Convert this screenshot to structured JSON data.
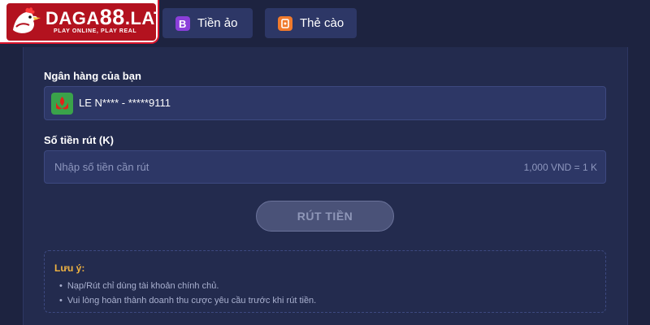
{
  "brand": {
    "name_prefix": "DAGA",
    "name_number": "88",
    "name_suffix": ".LAT",
    "tagline": "PLAY ONLINE, PLAY REAL",
    "colors": {
      "primary": "#b3121f",
      "accent": "#d9142b"
    }
  },
  "tabs": [
    {
      "label": "Tiền ảo",
      "icon": "bitcoin-icon",
      "icon_color": "#8b3fd9"
    },
    {
      "label": "Thẻ cào",
      "icon": "scratch-card-icon",
      "icon_color": "#f07a2c"
    }
  ],
  "form": {
    "bank_label": "Ngân hàng của bạn",
    "bank_value": "LE N**** - *****9111",
    "bank_icon": "bank-logo-icon",
    "amount_label": "Số tiền rút (K)",
    "amount_placeholder": "Nhập số tiền cần rút",
    "amount_value": "",
    "rate_text": "1,000 VND = 1 K",
    "submit_label": "RÚT TIỀN"
  },
  "note": {
    "title": "Lưu ý:",
    "items": [
      "Nạp/Rút chỉ dùng tài khoản chính chủ.",
      "Vui lòng hoàn thành doanh thu cược yêu cầu trước khi rút tiền."
    ]
  },
  "colors": {
    "background": "#1d2340",
    "panel": "#232b4e",
    "field": "#2d3766",
    "note_title": "#f0b341"
  }
}
